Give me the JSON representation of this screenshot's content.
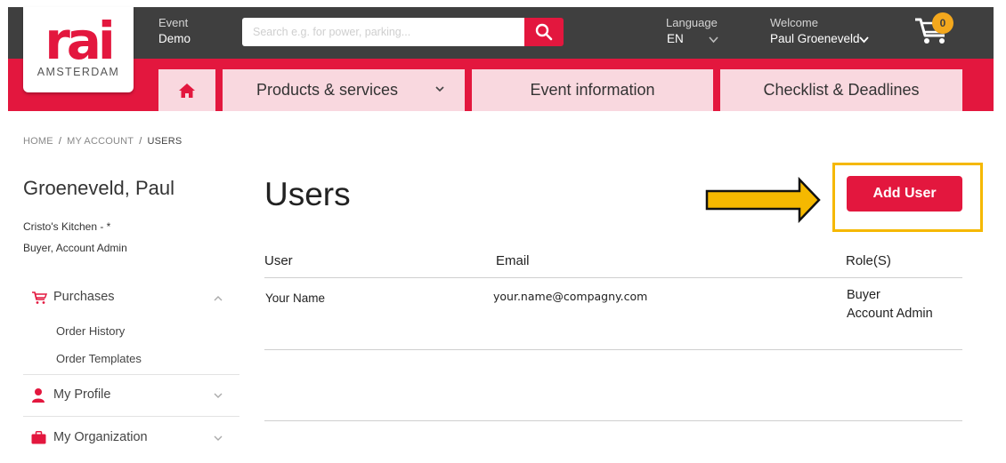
{
  "header": {
    "logo_text": "rai",
    "logo_subtitle": "AMSTERDAM",
    "event_label": "Event",
    "event_value": "Demo",
    "search_placeholder": "Search e.g. for power, parking...",
    "language_label": "Language",
    "language_value": "EN",
    "welcome_label": "Welcome",
    "user_name": "Paul Groeneveld",
    "cart_count": "0"
  },
  "nav": {
    "tabs": [
      {
        "label": "Products & services"
      },
      {
        "label": "Event information"
      },
      {
        "label": "Checklist & Deadlines"
      }
    ]
  },
  "breadcrumb": [
    "HOME",
    "MY ACCOUNT",
    "USERS"
  ],
  "sidebar": {
    "account_name": "Groeneveld, Paul",
    "company": "Cristo's Kitchen - *",
    "roles": "Buyer, Account Admin",
    "sections": [
      {
        "label": "Purchases",
        "icon": "cart-icon",
        "expanded": true,
        "items": [
          "Order History",
          "Order Templates"
        ]
      },
      {
        "label": "My Profile",
        "icon": "person-icon",
        "expanded": false
      },
      {
        "label": "My Organization",
        "icon": "briefcase-icon",
        "expanded": false
      }
    ]
  },
  "main": {
    "title": "Users",
    "add_user_label": "Add User",
    "columns": [
      "User",
      "Email",
      "Role(S)"
    ],
    "rows": [
      {
        "user": "Your Name",
        "email": "your.name@compagny.com",
        "roles": [
          "Buyer",
          "Account Admin"
        ]
      }
    ]
  },
  "colors": {
    "brand_red": "#e3173e",
    "header_dark": "#3f3f3f",
    "tab_pink": "#f9d8df",
    "highlight_yellow": "#f5b800"
  }
}
